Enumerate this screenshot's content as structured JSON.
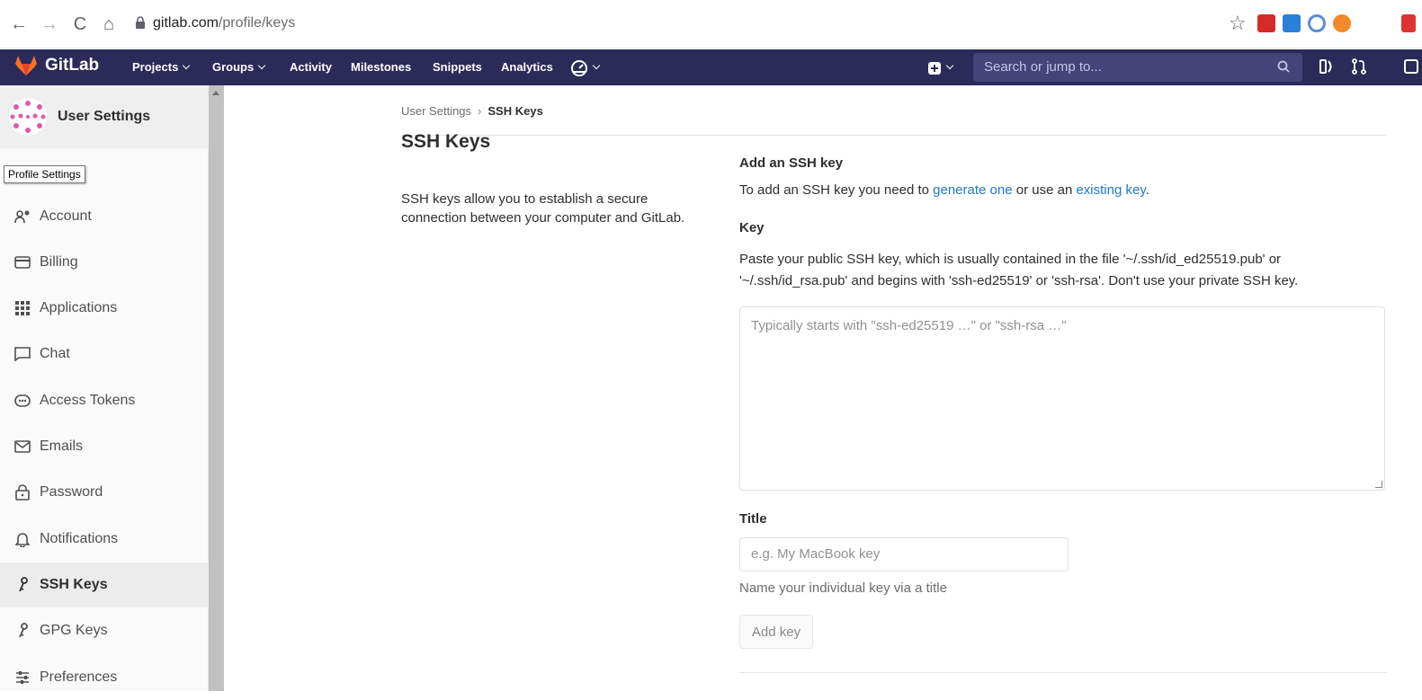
{
  "browser": {
    "url_host": "gitlab.com",
    "url_path": "/profile/keys"
  },
  "topnav": {
    "brand": "GitLab",
    "links": [
      "Projects",
      "Groups",
      "Activity",
      "Milestones",
      "Snippets",
      "Analytics"
    ],
    "search_placeholder": "Search or jump to..."
  },
  "sidebar": {
    "title": "User Settings",
    "tooltip": "Profile Settings",
    "items": [
      {
        "label": "Account",
        "icon": "account-icon"
      },
      {
        "label": "Billing",
        "icon": "credit-card-icon"
      },
      {
        "label": "Applications",
        "icon": "applications-icon"
      },
      {
        "label": "Chat",
        "icon": "comment-icon"
      },
      {
        "label": "Access Tokens",
        "icon": "token-icon"
      },
      {
        "label": "Emails",
        "icon": "mail-icon"
      },
      {
        "label": "Password",
        "icon": "lock-icon"
      },
      {
        "label": "Notifications",
        "icon": "bell-icon"
      },
      {
        "label": "SSH Keys",
        "icon": "key-icon",
        "active": true
      },
      {
        "label": "GPG Keys",
        "icon": "key-icon"
      },
      {
        "label": "Preferences",
        "icon": "preferences-icon"
      }
    ]
  },
  "breadcrumb": {
    "parent": "User Settings",
    "current": "SSH Keys"
  },
  "left": {
    "title": "SSH Keys",
    "description": "SSH keys allow you to establish a secure connection between your computer and GitLab."
  },
  "form": {
    "heading": "Add an SSH key",
    "intro_pre": "To add an SSH key you need to ",
    "intro_link1": "generate one",
    "intro_mid": " or use an ",
    "intro_link2": "existing key",
    "intro_post": ".",
    "key_label": "Key",
    "key_help": "Paste your public SSH key, which is usually contained in the file '~/.ssh/id_ed25519.pub' or '~/.ssh/id_rsa.pub' and begins with 'ssh-ed25519' or 'ssh-rsa'. Don't use your private SSH key.",
    "key_placeholder": "Typically starts with \"ssh-ed25519 …\" or \"ssh-rsa …\"",
    "title_label": "Title",
    "title_placeholder": "e.g. My MacBook key",
    "title_help": "Name your individual key via a title",
    "submit_label": "Add key"
  },
  "colors": {
    "nav_bg": "#2b2a58",
    "link": "#1f78d1",
    "search_bg": "#44437a"
  }
}
